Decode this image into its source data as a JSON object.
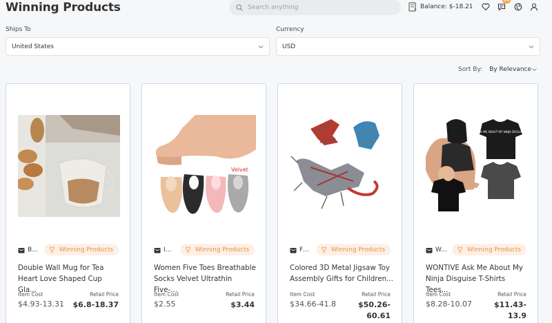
{
  "header": {
    "title": "Winning Products",
    "search_placeholder": "Search anything",
    "balance": "Balance: $-18.21",
    "messages_badge": "31",
    "icons": [
      "wallet-icon",
      "heart-icon",
      "chat-icon",
      "globe-icon",
      "user-icon"
    ]
  },
  "filters": {
    "ships_to_label": "Ships To",
    "ships_to_value": "United States",
    "currency_label": "Currency",
    "currency_value": "USD",
    "sort_label": "Sort By:",
    "sort_value": "By Relevance"
  },
  "colors": {
    "accent_orange": "#e8923c",
    "pill_bg": "#fdf0e6",
    "card_border": "#c7daf2"
  },
  "products": [
    {
      "store": "B...",
      "badge": "Winning Products",
      "name": "Double Wall Mug for Tea Heart Love Shaped Cup Gla...",
      "cost_label": "Item Cost",
      "cost": "$4.93-13.31",
      "retail_label": "Retail Price",
      "retail": "$6.8-18.37"
    },
    {
      "store": "IL...",
      "badge": "Winning Products",
      "name": "Women Five Toes Breathable Socks Velvet Ultrathin Five-...",
      "cost_label": "Item Cost",
      "cost": "$2.55",
      "retail_label": "Retail Price",
      "retail": "$3.44",
      "image_text": "Velvet"
    },
    {
      "store": "Fe...",
      "badge": "Winning Products",
      "name": "Colored 3D Metal Jigsaw Toy Assembly Gifts for Children...",
      "cost_label": "Item Cost",
      "cost": "$34.66-41.8",
      "retail_label": "Retail Price",
      "retail": "$50.26-60.61"
    },
    {
      "store": "W...",
      "badge": "Winning Products",
      "name": "WONTIVE Ask Me About My Ninja Disguise T-Shirts Tees...",
      "cost_label": "Item Cost",
      "cost": "$8.28-10.07",
      "retail_label": "Retail Price",
      "retail": "$11.43-13.9",
      "image_text": "ASK ME ABOUT MY NINJA DISGUISE"
    }
  ]
}
